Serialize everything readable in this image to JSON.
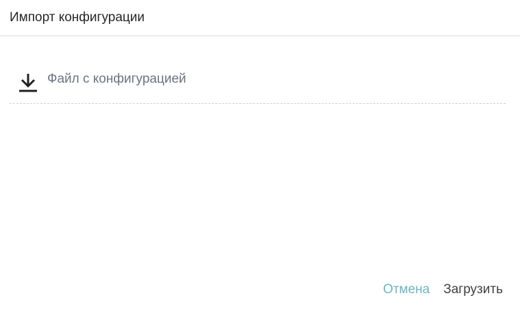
{
  "dialog": {
    "title": "Импорт конфигурации",
    "file_input": {
      "label": "Файл с конфигурацией",
      "icon": "download-icon"
    },
    "actions": {
      "cancel_label": "Отмена",
      "upload_label": "Загрузить"
    }
  },
  "colors": {
    "accent": "#6fb3c2",
    "text_primary": "#262626",
    "text_secondary": "#6b7380"
  }
}
